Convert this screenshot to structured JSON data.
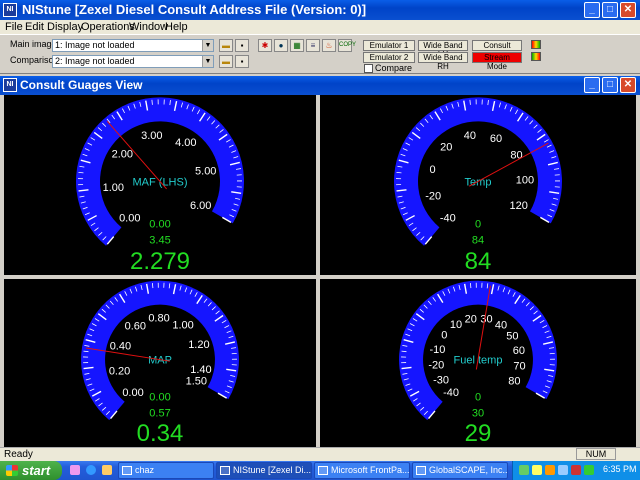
{
  "window": {
    "app_icon": "NI",
    "title": "NIStune [Zexel Diesel Consult Address File (Version: 0)]",
    "minimize": "_",
    "maximize": "□",
    "close": "✕"
  },
  "menu": [
    "File",
    "Edit",
    "Display",
    "Operations",
    "Window",
    "Help"
  ],
  "toolbar": {
    "main_image_label": "Main image:",
    "main_image_value": "1: Image not loaded",
    "comparison_label": "Comparison:",
    "comparison_value": "2: Image not loaded",
    "emulator1": "Emulator 1",
    "emulator2": "Emulator 2",
    "wide_band_lh": "Wide Band LH",
    "wide_band_rh": "Wide Band RH",
    "consult": "Consult",
    "stream_mode": "Stream Mode",
    "compare": "Compare"
  },
  "child": {
    "title": "Consult Guages View"
  },
  "gauges": [
    {
      "name": "MAF (LHS)",
      "min": 0.0,
      "max": 6.0,
      "ticks": [
        "0.00",
        "1.00",
        "2.00",
        "3.00",
        "4.00",
        "5.00",
        "6.00"
      ],
      "recorded_min": "0.00",
      "recorded_max": "3.45",
      "value_text": "2.279",
      "value": 2.279
    },
    {
      "name": "Temp",
      "min": -40,
      "max": 120,
      "ticks": [
        "-40",
        "-20",
        "0",
        "20",
        "40",
        "60",
        "80",
        "100",
        "120"
      ],
      "recorded_min": "0",
      "recorded_max": "84",
      "value_text": "84",
      "value": 84
    },
    {
      "name": "MAP",
      "min": 0.0,
      "max": 1.5,
      "ticks": [
        "0.00",
        "0.20",
        "0.40",
        "0.60",
        "0.80",
        "1.00",
        "1.20",
        "1.40",
        "1.50"
      ],
      "recorded_min": "0.00",
      "recorded_max": "0.57",
      "value_text": "0.34",
      "value": 0.34
    },
    {
      "name": "Fuel temp",
      "min": -40,
      "max": 80,
      "ticks": [
        "-40",
        "-30",
        "-20",
        "-10",
        "0",
        "10",
        "20",
        "30",
        "40",
        "50",
        "60",
        "70",
        "80"
      ],
      "recorded_min": "0",
      "recorded_max": "30",
      "value_text": "29",
      "value": 29
    }
  ],
  "colors": {
    "dial": "#1515ff",
    "needle": "#e01010",
    "value": "#22dd22",
    "label": "#22cccc",
    "ticks": "#ffffff"
  },
  "status": {
    "text": "Ready",
    "num": "NUM"
  },
  "taskbar": {
    "start": "start",
    "items": [
      "chaz",
      "NIStune [Zexel Di...",
      "Microsoft FrontPa...",
      "GlobalSCAPE, Inc...."
    ],
    "clock": "6:35 PM"
  }
}
